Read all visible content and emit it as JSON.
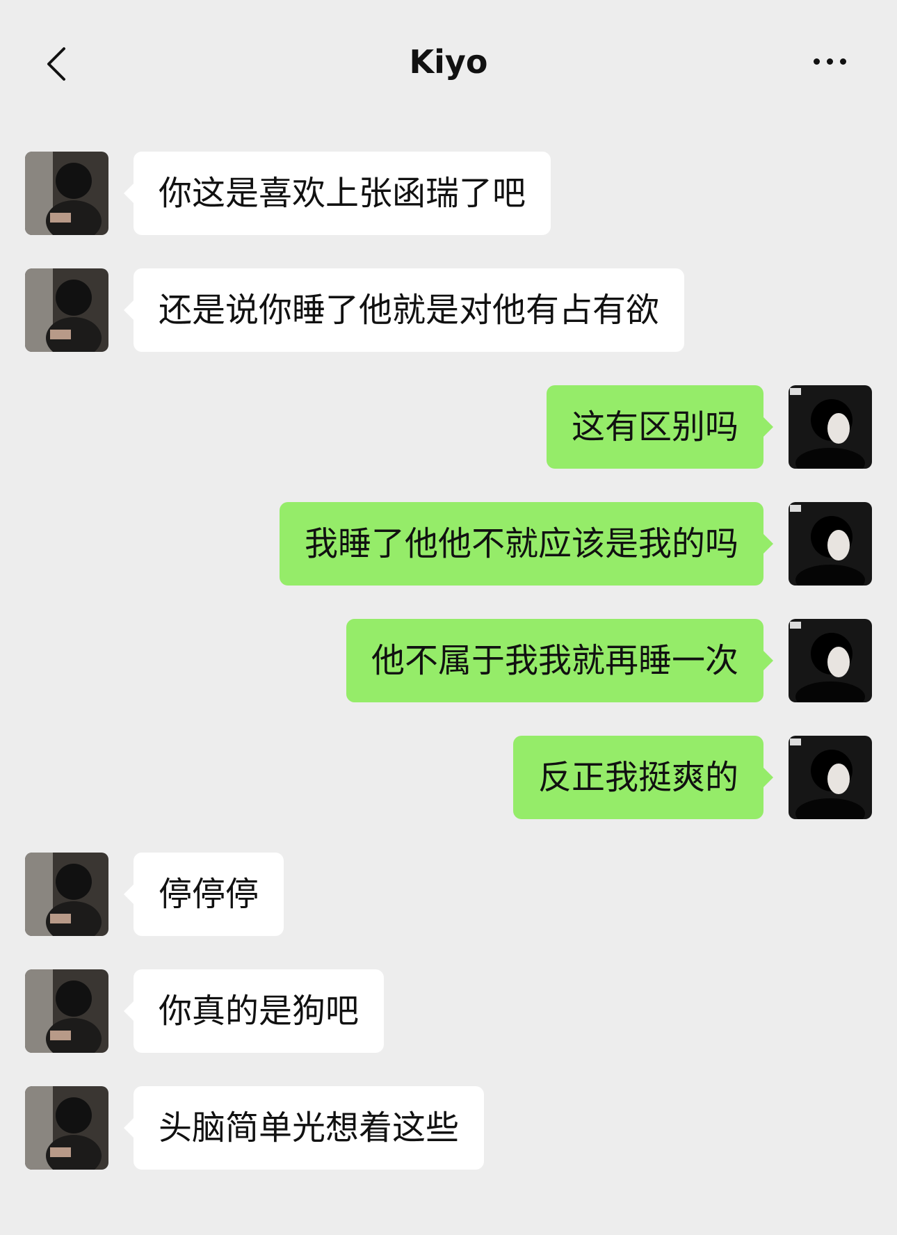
{
  "header": {
    "title": "Kiyo",
    "back_icon": "chevron-left-icon",
    "more_icon": "ellipsis-icon"
  },
  "colors": {
    "background": "#ededed",
    "incoming_bubble": "#ffffff",
    "outgoing_bubble": "#95ec69"
  },
  "messages": [
    {
      "side": "left",
      "text": "你这是喜欢上张函瑞了吧"
    },
    {
      "side": "left",
      "text": "还是说你睡了他就是对他有占有欲"
    },
    {
      "side": "right",
      "text": "这有区别吗"
    },
    {
      "side": "right",
      "text": "我睡了他他不就应该是我的吗"
    },
    {
      "side": "right",
      "text": "他不属于我我就再睡一次"
    },
    {
      "side": "right",
      "text": "反正我挺爽的"
    },
    {
      "side": "left",
      "text": "停停停"
    },
    {
      "side": "left",
      "text": "你真的是狗吧"
    },
    {
      "side": "left",
      "text": "头脑简单光想着这些"
    }
  ]
}
